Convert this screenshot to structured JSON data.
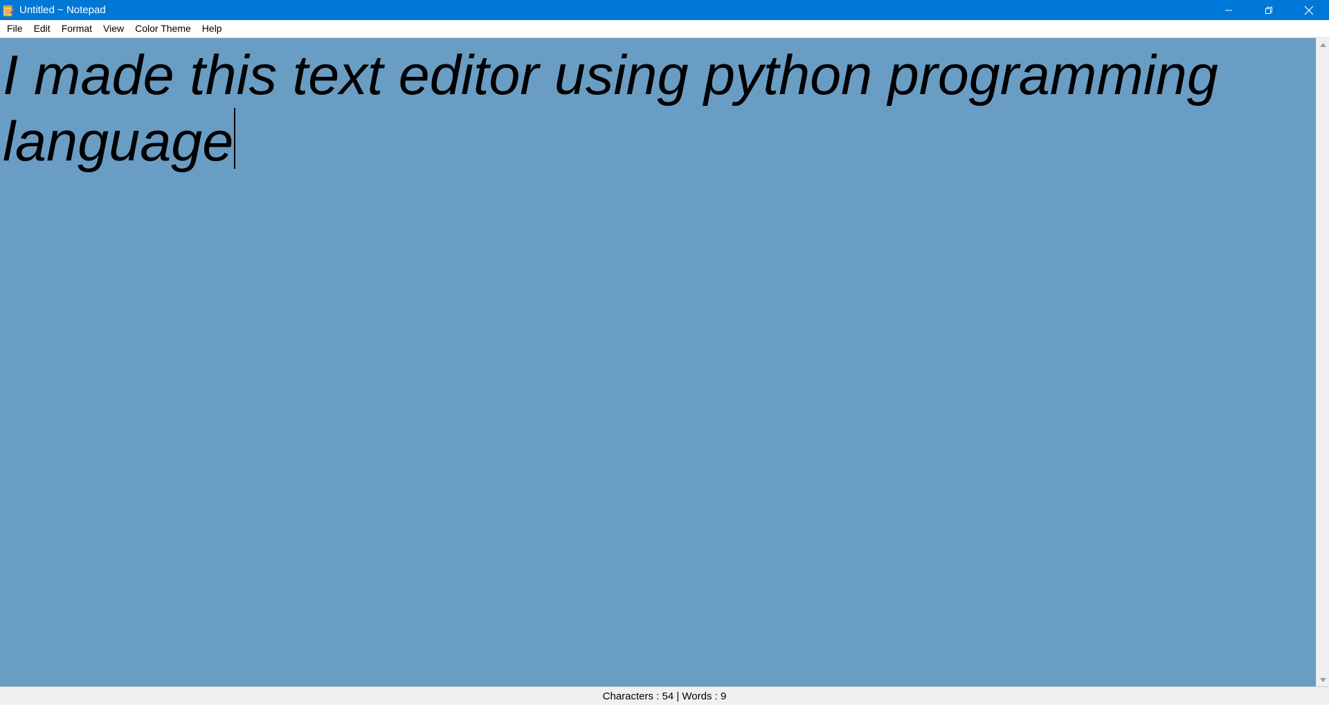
{
  "window": {
    "title": "Untitled ~ Notepad",
    "accent_color": "#0078d7"
  },
  "menu": {
    "items": [
      {
        "label": "File"
      },
      {
        "label": "Edit"
      },
      {
        "label": "Format"
      },
      {
        "label": "View"
      },
      {
        "label": "Color Theme"
      },
      {
        "label": "Help"
      }
    ]
  },
  "editor": {
    "text": "I made this text editor using python programming language",
    "background_color": "#6a9dc3",
    "text_color": "#000000"
  },
  "status": {
    "text": "Characters : 54 | Words : 9"
  },
  "icons": {
    "app": "notepad-app-icon",
    "minimize": "minimize-icon",
    "restore": "restore-icon",
    "close": "close-icon",
    "scroll_up": "scroll-up-arrow-icon",
    "scroll_down": "scroll-down-arrow-icon"
  }
}
